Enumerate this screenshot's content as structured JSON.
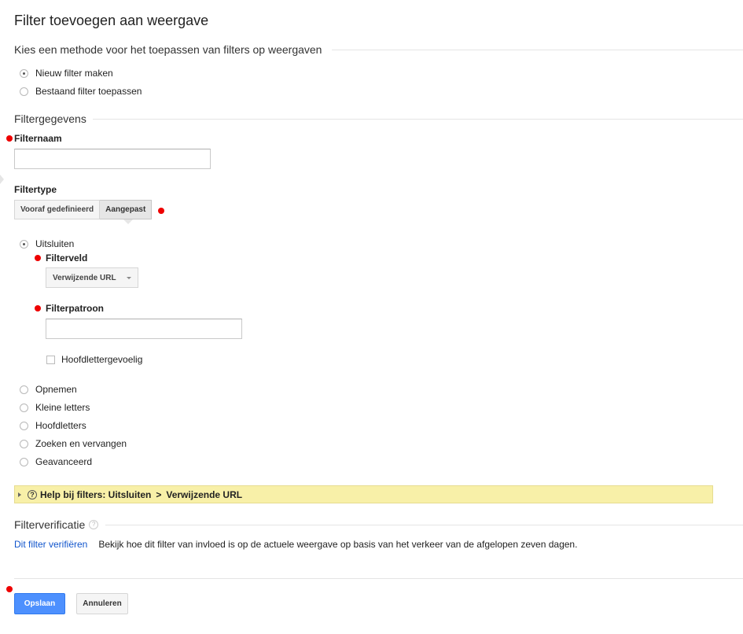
{
  "page": {
    "title": "Filter toevoegen aan weergave"
  },
  "method": {
    "heading": "Kies een methode voor het toepassen van filters op weergaven",
    "options": [
      {
        "label": "Nieuw filter maken",
        "checked": true
      },
      {
        "label": "Bestaand filter toepassen",
        "checked": false
      }
    ]
  },
  "details": {
    "heading": "Filtergegevens",
    "filter_name_label": "Filternaam",
    "filter_name_value": "",
    "filter_type_label": "Filtertype",
    "type_tabs": [
      {
        "label": "Vooraf gedefinieerd",
        "active": false
      },
      {
        "label": "Aangepast",
        "active": true
      }
    ],
    "custom_options": [
      {
        "label": "Uitsluiten",
        "checked": true
      },
      {
        "label": "Opnemen",
        "checked": false
      },
      {
        "label": "Kleine letters",
        "checked": false
      },
      {
        "label": "Hoofdletters",
        "checked": false
      },
      {
        "label": "Zoeken en vervangen",
        "checked": false
      },
      {
        "label": "Geavanceerd",
        "checked": false
      }
    ],
    "filter_field_label": "Filterveld",
    "filter_field_value": "Verwijzende URL",
    "filter_pattern_label": "Filterpatroon",
    "filter_pattern_value": "",
    "case_sensitive_label": "Hoofdlettergevoelig",
    "case_sensitive_checked": false
  },
  "help": {
    "prefix": "Help bij filters: Uitsluiten",
    "separator": ">",
    "suffix": "Verwijzende URL"
  },
  "verification": {
    "heading": "Filterverificatie",
    "link": "Dit filter verifiëren",
    "description": "Bekijk hoe dit filter van invloed is op de actuele weergave op basis van het verkeer van de afgelopen zeven dagen."
  },
  "actions": {
    "save": "Opslaan",
    "cancel": "Annuleren"
  },
  "colors": {
    "required": "#e00000",
    "primary": "#4d90fe",
    "help_bg": "#f8f0a8",
    "link": "#1155cc"
  }
}
